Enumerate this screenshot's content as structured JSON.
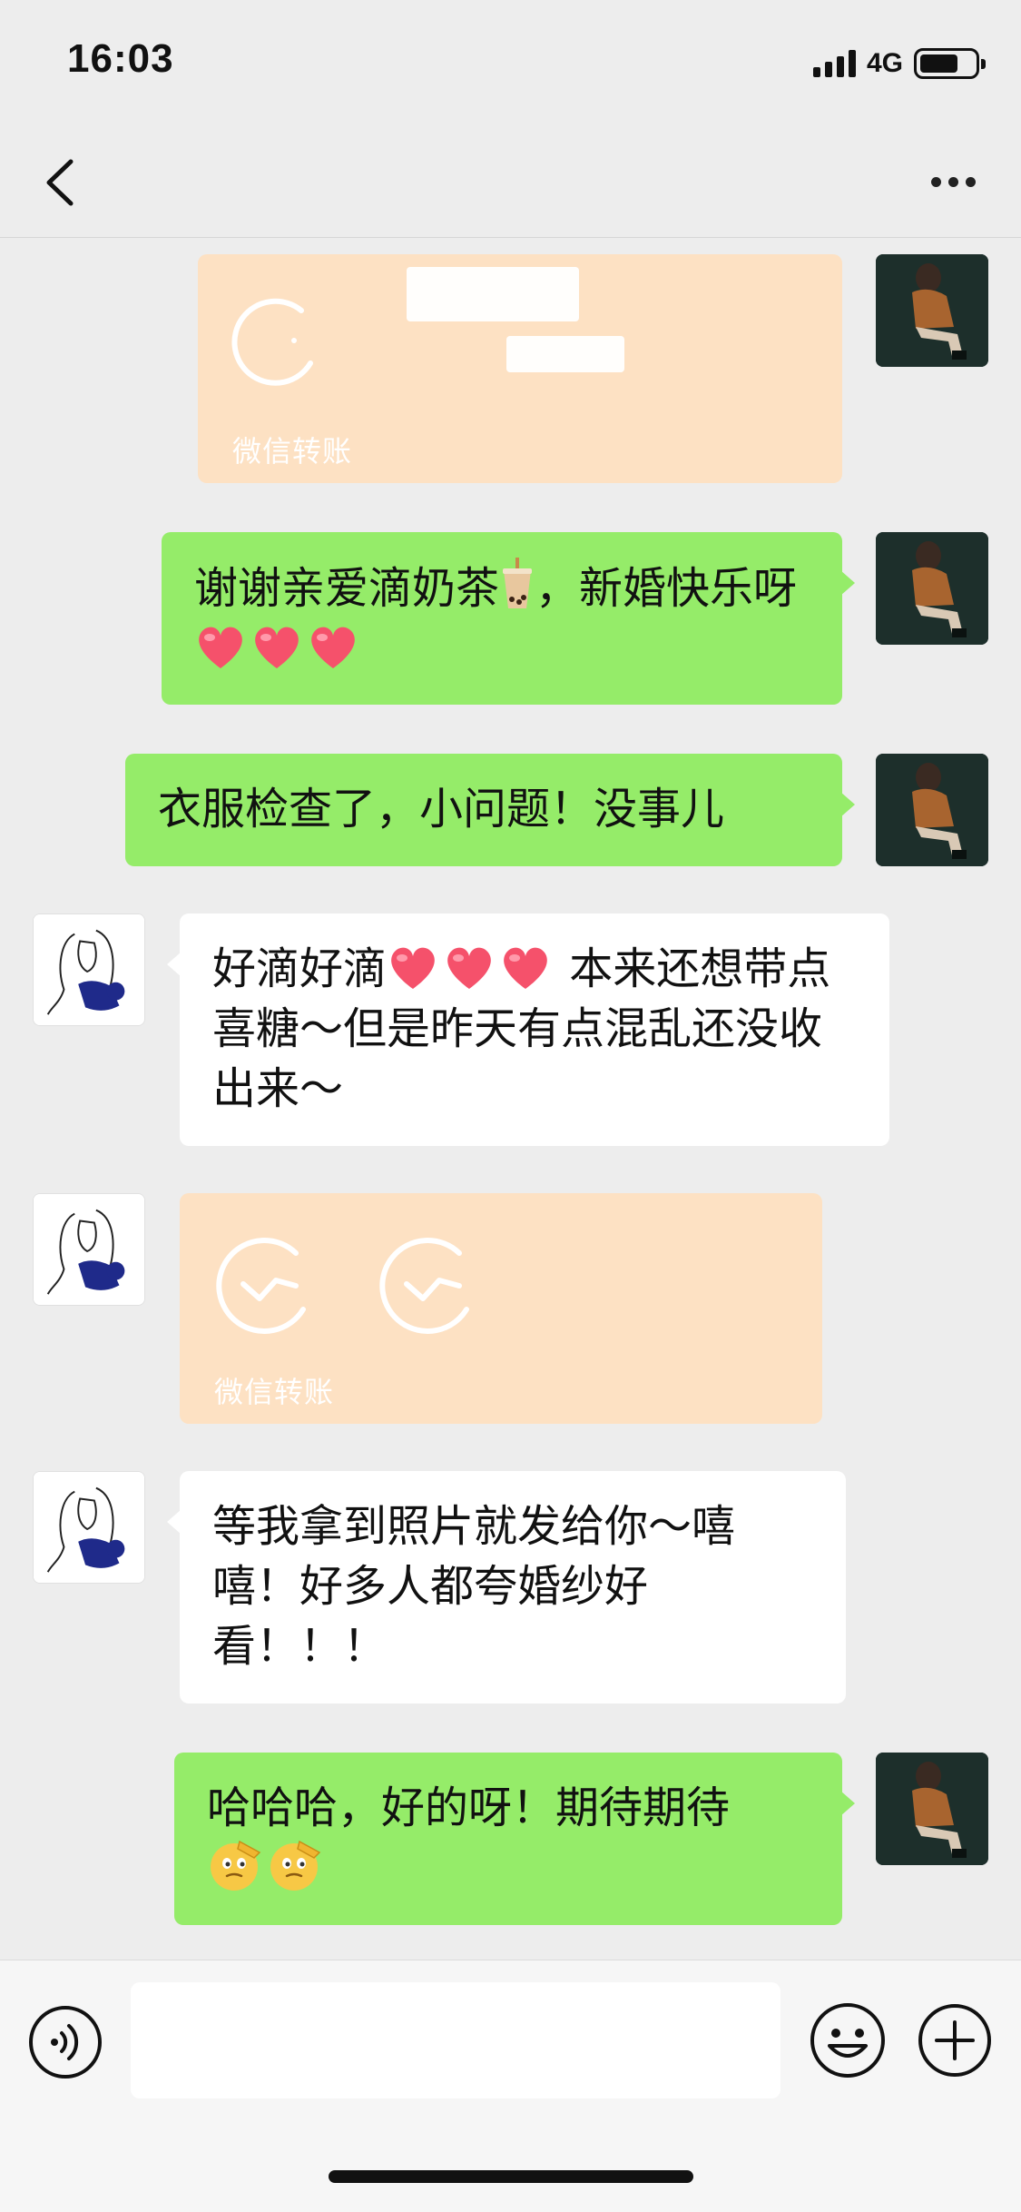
{
  "status_bar": {
    "time": "16:03",
    "network": "4G",
    "battery_level": 0.7
  },
  "nav": {
    "title": "",
    "back_icon": "chevron-left-icon",
    "more_icon": "more-dots-icon"
  },
  "messages": [
    {
      "type": "transfer",
      "sender": "me",
      "label": "微信转账"
    },
    {
      "type": "text",
      "sender": "me",
      "text_a": "谢谢亲爱滴奶茶",
      "text_b": "，新婚快乐呀",
      "emoji": [
        "bubble-tea",
        "heart",
        "heart",
        "heart"
      ]
    },
    {
      "type": "text",
      "sender": "me",
      "text": "衣服检查了，小问题！没事儿"
    },
    {
      "type": "text",
      "sender": "her",
      "text_a": "好滴好滴",
      "text_b": " 本来还想带点喜糖～但是昨天有点混乱还没收出来～",
      "emoji": [
        "heart",
        "heart",
        "heart"
      ]
    },
    {
      "type": "transfer",
      "sender": "her",
      "label": "微信转账"
    },
    {
      "type": "text",
      "sender": "her",
      "text": "等我拿到照片就发给你～嘻嘻！好多人都夸婚纱好看！！！"
    },
    {
      "type": "text",
      "sender": "me",
      "text": "哈哈哈，好的呀！期待期待",
      "emoji": [
        "salute-face",
        "salute-face"
      ]
    }
  ],
  "input_bar": {
    "placeholder": "",
    "voice_icon": "voice-icon",
    "emoji_icon": "emoji-icon",
    "plus_icon": "plus-icon"
  },
  "colors": {
    "background": "#ededed",
    "my_bubble": "#95ec69",
    "their_bubble": "#ffffff",
    "transfer_card": "#fde1c3"
  }
}
